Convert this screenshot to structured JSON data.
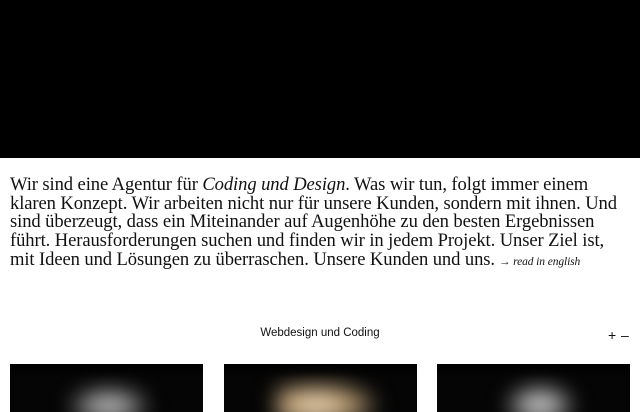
{
  "intro": {
    "text_1": "Wir sind eine Agentur für ",
    "text_emph": "Coding und Design",
    "text_2": ". Was wir tun, folgt immer einem klaren Konzept. Wir arbeiten nicht nur für unsere Kunden, sondern mit ihnen. Und sind überzeugt, dass ein Miteinander auf Augenhöhe zu den besten Ergebnissen führt. Herausforderungen suchen und finden wir in jedem Projekt. Unser Ziel ist, mit Ideen und Lösungen zu überraschen. Unsere Kunden und uns.",
    "read_link": "→ read in english"
  },
  "filter": {
    "label": "Webdesign und Coding",
    "expand": "+",
    "collapse": "–"
  },
  "projects": [
    {
      "icon": "project-thumbnail"
    },
    {
      "icon": "project-thumbnail"
    },
    {
      "icon": "project-thumbnail"
    }
  ]
}
